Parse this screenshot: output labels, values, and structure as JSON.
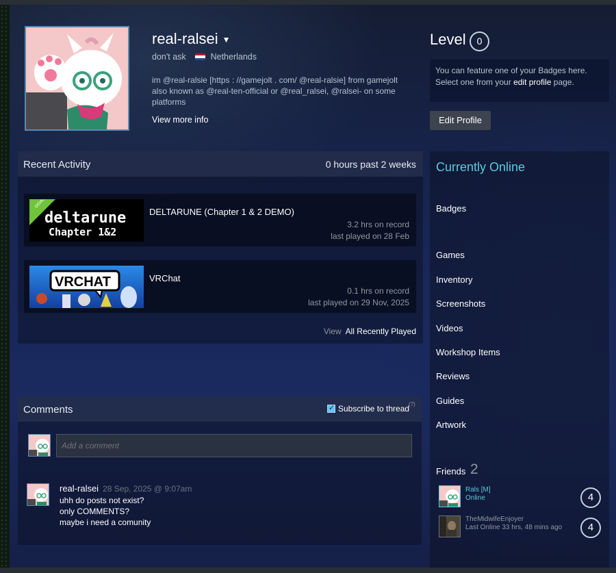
{
  "profile": {
    "name": "real-ralsei",
    "caret": "▼",
    "tagline": "don't ask",
    "country": "Netherlands",
    "summary": "im @real-ralsie [https : //gamejolt . com/ @real-ralsie] from gamejolt also known as @real-ten-official or @real_ralsei, @ralsei- on some platforms",
    "view_more": "View more info"
  },
  "level": {
    "label": "Level",
    "value": "0",
    "badge_note_pre": "You can feature one of your Badges here. Select one from your",
    "badge_note_link": "edit profile",
    "badge_note_post": "page.",
    "edit_button": "Edit Profile"
  },
  "activity": {
    "title": "Recent Activity",
    "summary": "0 hours past 2 weeks",
    "games": [
      {
        "name": "DELTARUNE (Chapter 1 & 2 DEMO)",
        "hours": "3.2 hrs on record",
        "last": "last played on 28 Feb",
        "cap_line1": "deltarune",
        "cap_line2": "Chapter 1&2",
        "badge": "DEMO"
      },
      {
        "name": "VRChat",
        "hours": "0.1 hrs on record",
        "last": "last played on 29 Nov, 2025",
        "cap_line1": "VRCHAT"
      }
    ],
    "view_label": "View",
    "view_link": "All Recently Played"
  },
  "comments": {
    "title": "Comments",
    "subscribe": "Subscribe to thread",
    "help": "(?)",
    "placeholder": "Add a comment",
    "items": [
      {
        "author": "real-ralsei",
        "time": "28 Sep, 2025 @ 9:07am",
        "lines": [
          "uhh do posts not exist?",
          "only COMMENTS?",
          "maybe i need a comunity"
        ]
      }
    ]
  },
  "sidebar": {
    "status": "Currently Online",
    "links": [
      "Badges",
      "Games",
      "Inventory",
      "Screenshots",
      "Videos",
      "Workshop Items",
      "Reviews",
      "Guides",
      "Artwork"
    ],
    "friends_label": "Friends",
    "friends_count": "2",
    "friends": [
      {
        "name": "Rals [M]",
        "status": "Online",
        "level": "4",
        "color": "#57cbde"
      },
      {
        "name": "TheMidwifeEnjoyer",
        "status": "Last Online 33 hrs, 48 mins ago",
        "level": "4",
        "color": "#8f98a0"
      }
    ]
  },
  "colors": {
    "accent": "#57cbde",
    "online": "#57cbde",
    "button": "#3d4450"
  }
}
